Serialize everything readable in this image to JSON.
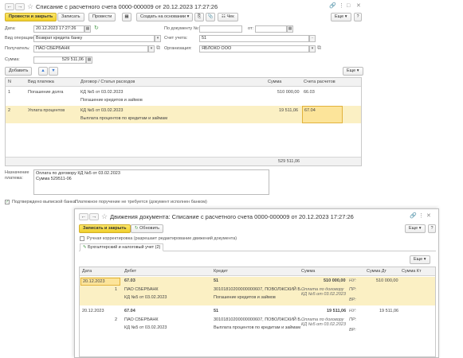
{
  "doc": {
    "title": "Списание с расчетного счета 0000-000009 от 20.12.2023 17:27:26",
    "toolbar": {
      "post_close": "Провести и закрыть",
      "save": "Записать",
      "post": "Провести",
      "create_based": "Создать на основании",
      "receipt": "Чек",
      "more": "Еще",
      "help": "?"
    },
    "fields": {
      "date_label": "Дата:",
      "date_value": "20.12.2023 17:27:26",
      "by_doc_label": "По документу №:",
      "from_label": "от:",
      "op_label": "Вид операции:",
      "op_value": "Возврат кредита банку",
      "account_label": "Счет учета:",
      "account_value": "51",
      "recipient_label": "Получатель:",
      "recipient_value": "ПАО СБЕРБАНК",
      "org_label": "Организация:",
      "org_value": "ЯБЛОКО ООО",
      "sum_label": "Сумма:",
      "sum_value": "529 511,06"
    },
    "table_toolbar": {
      "add": "Добавить",
      "more": "Еще"
    },
    "table": {
      "headers": [
        "N",
        "Вид платежа",
        "Договор / Статья расходов",
        "Сумма",
        "Счета расчетов"
      ],
      "rows": [
        {
          "n": "1",
          "type": "Погашение долга",
          "contract": "КД №5 от 03.02.2023",
          "article": "Погашение кредитов и займов",
          "sum": "510 000,00",
          "account": "66.03"
        },
        {
          "n": "2",
          "type": "Уплата процентов",
          "contract": "КД №5 от 03.02.2023",
          "article": "Выплата процентов по кредитам и займам",
          "sum": "19 511,06",
          "account": "67.04"
        }
      ],
      "total": "529 511,06"
    },
    "purpose_label": "Назначение платежа:",
    "purpose_lines": [
      "Оплата по договору КД №5 от 03.02.2023",
      "Сумма 529511-06"
    ],
    "confirm_label": "Подтверждено выпиской банка:",
    "confirm_note": "Платежное поручение не требуется (документ исполнен банком)"
  },
  "movements": {
    "title": "Движения документа: Списание с расчетного счета 0000-000009 от 20.12.2023 17:27:26",
    "toolbar": {
      "save_close": "Записать и закрыть",
      "refresh": "Обновить",
      "more": "Еще",
      "help": "?"
    },
    "manual_label": "Ручная корректировка (разрешает редактирование движений документа)",
    "tab": "Бухгалтерский и налоговый учет (2)",
    "more": "Еще",
    "headers": [
      "Дата",
      "Дебет",
      "Кредит",
      "Сумма",
      "Сумма Дт",
      "Сумма Кт"
    ],
    "entries": [
      {
        "date": "20.12.2023",
        "n": "1",
        "debit": "67.03",
        "credit": "51",
        "sum": "510 000,00",
        "sum_dt": "510 000,00",
        "debit_sub1": "ПАО СБЕРБАНК",
        "debit_sub2": "КД №5 от 03.02.2023",
        "credit_sub1": "30101810200000000607, ПОВОЛЖСКИЙ Б...",
        "credit_sub2": "Погашение кредитов и займов",
        "desc1": "Оплата по договору",
        "desc2": "КД №5 от 03.02.2023",
        "codes": [
          "НУ:",
          "ПР:",
          "ВР:"
        ]
      },
      {
        "date": "20.12.2023",
        "n": "2",
        "debit": "67.04",
        "credit": "51",
        "sum": "19 511,06",
        "sum_dt": "19 511,06",
        "debit_sub1": "ПАО СБЕРБАНК",
        "debit_sub2": "КД №5 от 03.02.2023",
        "credit_sub1": "30101810200000000607, ПОВОЛЖСКИЙ Б...",
        "credit_sub2": "Выплата процентов по кредитам и займам",
        "desc1": "Оплата по договору",
        "desc2": "КД №5 от 03.02.2023",
        "codes": [
          "НУ:",
          "ПР:",
          "ВР:"
        ]
      }
    ]
  },
  "colors": {
    "primary_button": "#f0cf2b",
    "selected_row": "#fbf0c4"
  }
}
